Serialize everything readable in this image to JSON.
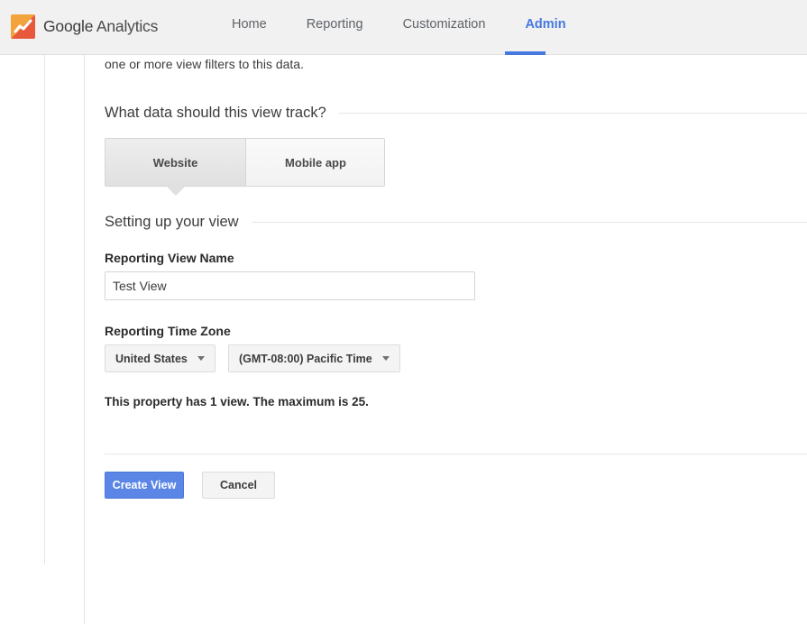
{
  "header": {
    "brand": {
      "logo_icon": "analytics-chart-icon",
      "name_bold": "Google",
      "name_light": " Analytics"
    },
    "nav": [
      {
        "label": "Home",
        "active": false
      },
      {
        "label": "Reporting",
        "active": false
      },
      {
        "label": "Customization",
        "active": false
      },
      {
        "label": "Admin",
        "active": true
      }
    ],
    "accent_color": "#4678e0",
    "background_color": "#f1f1f1"
  },
  "main": {
    "intro_text_clipped": "one or more view filters to this data.",
    "track_section": {
      "heading": "What data should this view track?",
      "options": [
        {
          "label": "Website",
          "selected": true
        },
        {
          "label": "Mobile app",
          "selected": false
        }
      ]
    },
    "setup_section": {
      "heading": "Setting up your view",
      "view_name": {
        "label": "Reporting View Name",
        "value": "Test View",
        "placeholder": ""
      },
      "time_zone": {
        "label": "Reporting Time Zone",
        "country": "United States",
        "zone": "(GMT-08:00) Pacific Time"
      },
      "quota_note": "This property has 1 view. The maximum is 25."
    },
    "actions": {
      "primary": "Create View",
      "secondary": "Cancel",
      "primary_color": "#5b86e5"
    }
  }
}
